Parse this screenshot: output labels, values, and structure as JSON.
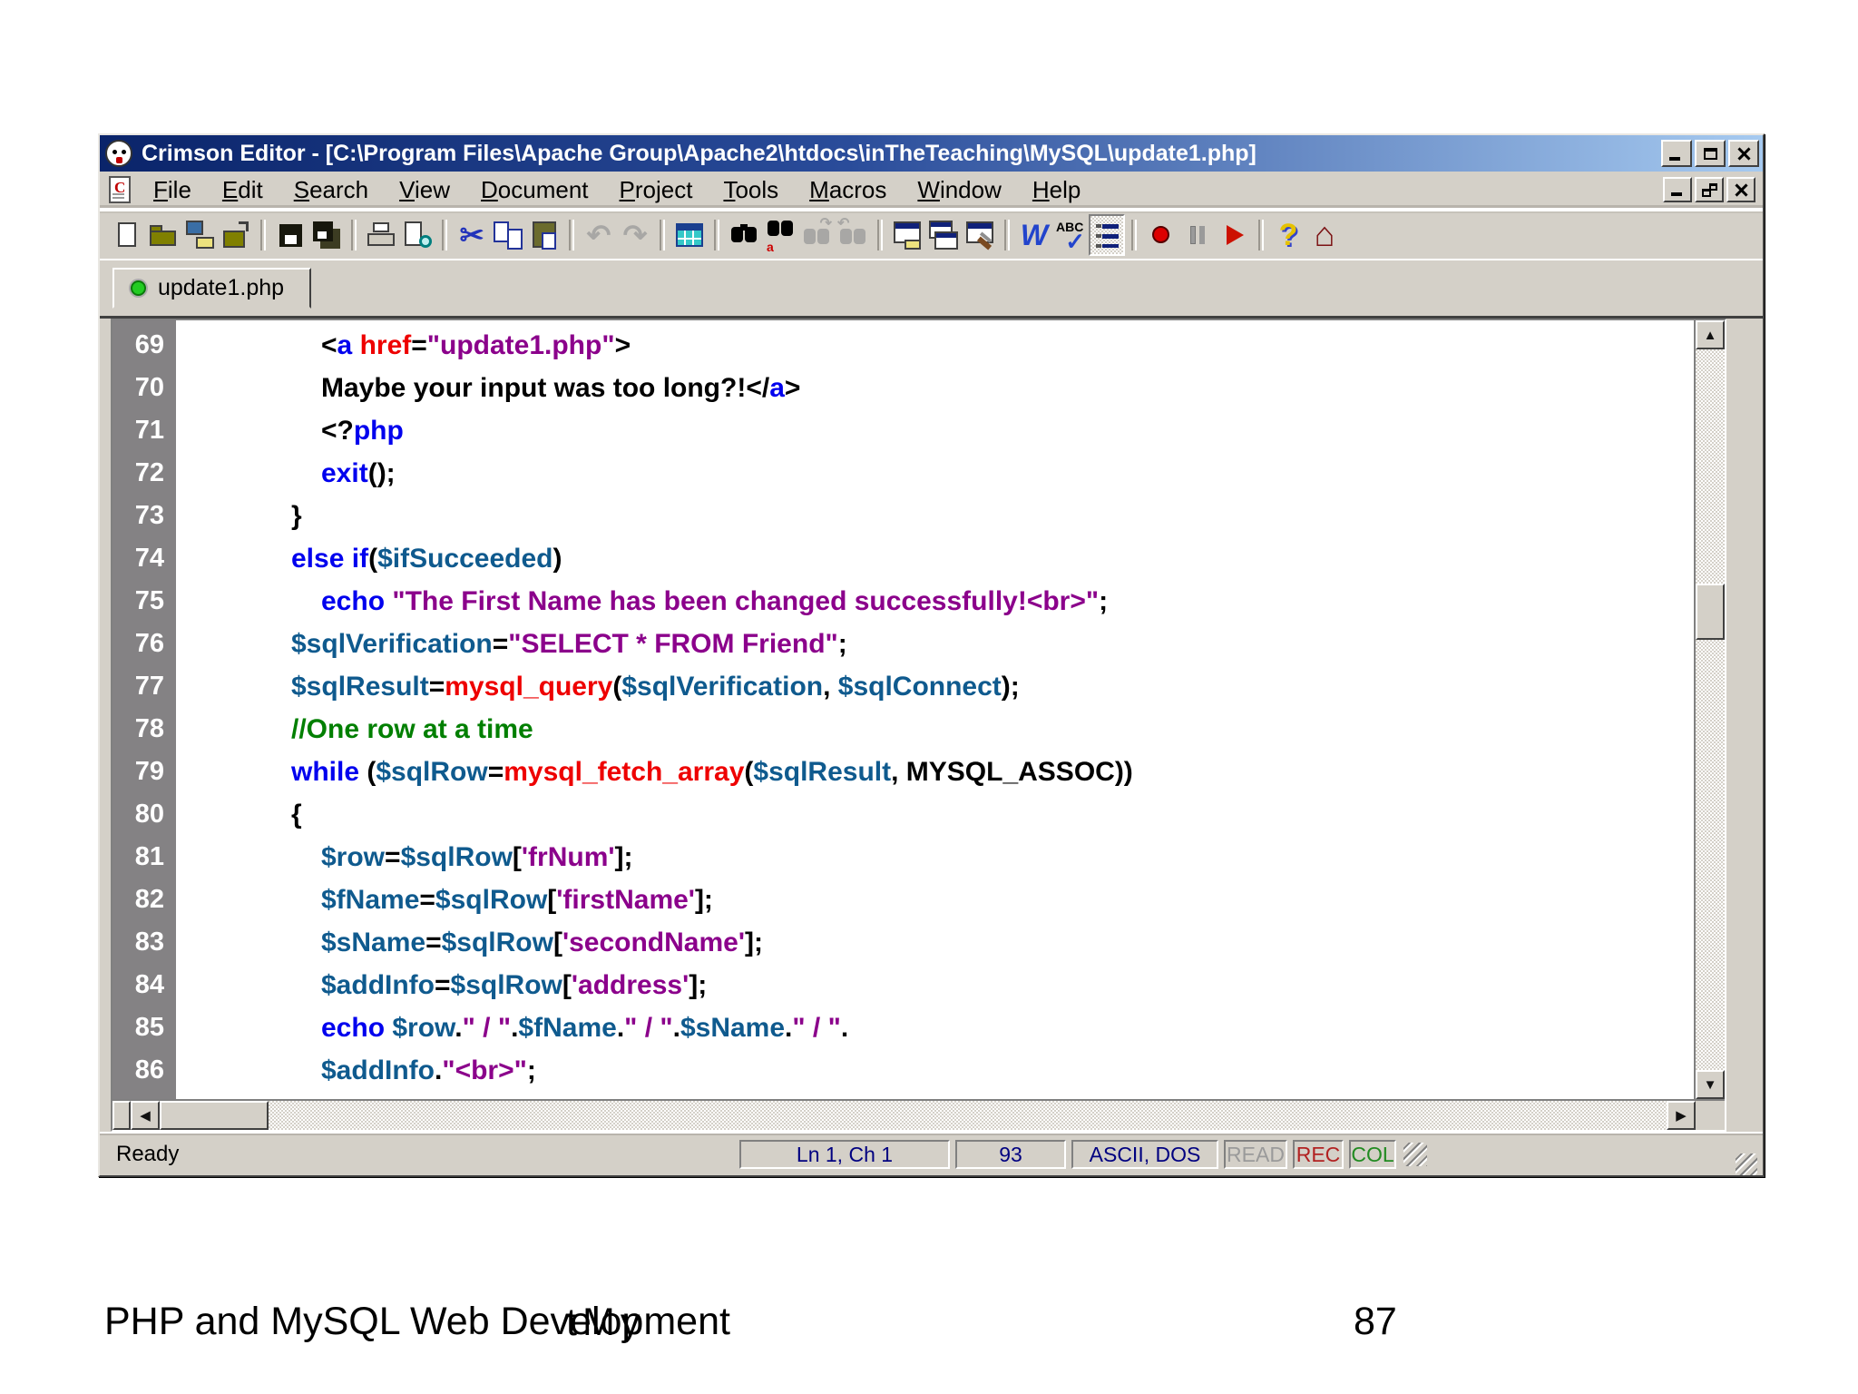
{
  "window": {
    "title": "Crimson Editor - [C:\\Program Files\\Apache Group\\Apache2\\htdocs\\inTheTeaching\\MySQL\\update1.php]",
    "menu": [
      "File",
      "Edit",
      "Search",
      "View",
      "Document",
      "Project",
      "Tools",
      "Macros",
      "Window",
      "Help"
    ],
    "toolbar": {
      "groups": [
        [
          {
            "name": "new-file-icon"
          },
          {
            "name": "open-file-icon"
          },
          {
            "name": "open-remote-icon"
          },
          {
            "name": "close-folder-icon"
          }
        ],
        [
          {
            "name": "save-icon"
          },
          {
            "name": "save-all-icon"
          }
        ],
        [
          {
            "name": "print-icon"
          },
          {
            "name": "print-preview-icon"
          }
        ],
        [
          {
            "name": "cut-icon",
            "glyph": "✂"
          },
          {
            "name": "copy-icon"
          },
          {
            "name": "paste-icon"
          }
        ],
        [
          {
            "name": "undo-icon",
            "glyph": "↶",
            "disabled": true
          },
          {
            "name": "redo-icon",
            "glyph": "↷",
            "disabled": true
          }
        ],
        [
          {
            "name": "grid-icon"
          }
        ],
        [
          {
            "name": "find-icon"
          },
          {
            "name": "replace-icon"
          },
          {
            "name": "find-next-icon",
            "disabled": true
          },
          {
            "name": "find-prev-icon",
            "disabled": true
          }
        ],
        [
          {
            "name": "project-pane-icon"
          },
          {
            "name": "window-list-icon"
          },
          {
            "name": "tools-pane-icon"
          }
        ],
        [
          {
            "name": "word-wrap-icon",
            "glyph": "W"
          },
          {
            "name": "spell-check-icon"
          },
          {
            "name": "line-numbers-icon",
            "pressed": true
          }
        ],
        [
          {
            "name": "record-macro-icon"
          },
          {
            "name": "pause-macro-icon"
          },
          {
            "name": "play-macro-icon"
          }
        ],
        [
          {
            "name": "help-icon",
            "glyph": "?"
          },
          {
            "name": "home-icon",
            "glyph": "⌂"
          }
        ]
      ]
    },
    "tab": {
      "label": "update1.php"
    },
    "status": {
      "ready": "Ready",
      "panels": [
        {
          "text": "Ln 1, Ch 1",
          "style": "navy"
        },
        {
          "text": "93",
          "style": "navy"
        },
        {
          "text": "ASCII, DOS",
          "style": "navy"
        },
        {
          "text": "READ",
          "style": "muted"
        },
        {
          "text": "REC",
          "style": "red"
        },
        {
          "text": "COL",
          "style": "green"
        }
      ]
    }
  },
  "icons": {
    "up": "▲",
    "down": "▼",
    "left": "◀",
    "right": "▶"
  },
  "colors": {
    "titlebar_start": "#0A246A",
    "titlebar_end": "#A6CAF0",
    "chrome": "#D4D0C8",
    "gutter": "#848284",
    "keyword": "#0000EE",
    "function": "#EE0000",
    "string": "#8B008B",
    "variable": "#0F5A8E",
    "comment": "#007F00"
  },
  "editor": {
    "lines": [
      {
        "n": 69,
        "i": 2,
        "t": [
          [
            "p",
            "<"
          ],
          [
            "k",
            "a"
          ],
          [
            "p",
            " "
          ],
          [
            "f",
            "href"
          ],
          [
            "p",
            "="
          ],
          [
            "s",
            "\"update1.php\""
          ],
          [
            "p",
            ">"
          ]
        ]
      },
      {
        "n": 70,
        "i": 2,
        "t": [
          [
            "p",
            "Maybe your input was too long?!"
          ],
          [
            "p",
            "</"
          ],
          [
            "k",
            "a"
          ],
          [
            "p",
            ">"
          ]
        ]
      },
      {
        "n": 71,
        "i": 2,
        "t": [
          [
            "p",
            "<?"
          ],
          [
            "k",
            "php"
          ]
        ]
      },
      {
        "n": 72,
        "i": 2,
        "t": [
          [
            "k",
            "exit"
          ],
          [
            "p",
            "();"
          ]
        ]
      },
      {
        "n": 73,
        "i": 1,
        "t": [
          [
            "p",
            "}"
          ]
        ]
      },
      {
        "n": 74,
        "i": 1,
        "t": [
          [
            "k",
            "else"
          ],
          [
            "p",
            " "
          ],
          [
            "k",
            "if"
          ],
          [
            "p",
            "("
          ],
          [
            "v",
            "$ifSucceeded"
          ],
          [
            "p",
            ")"
          ]
        ]
      },
      {
        "n": 75,
        "i": 2,
        "t": [
          [
            "k",
            "echo"
          ],
          [
            "p",
            " "
          ],
          [
            "s",
            "\"The First Name has been changed successfully!<br>\""
          ],
          [
            "p",
            ";"
          ]
        ]
      },
      {
        "n": 76,
        "i": 1,
        "t": [
          [
            "v",
            "$sqlVerification"
          ],
          [
            "p",
            "="
          ],
          [
            "s",
            "\"SELECT * FROM Friend\""
          ],
          [
            "p",
            ";"
          ]
        ]
      },
      {
        "n": 77,
        "i": 1,
        "t": [
          [
            "v",
            "$sqlResult"
          ],
          [
            "p",
            "="
          ],
          [
            "f",
            "mysql_query"
          ],
          [
            "p",
            "("
          ],
          [
            "v",
            "$sqlVerification"
          ],
          [
            "p",
            ", "
          ],
          [
            "v",
            "$sqlConnect"
          ],
          [
            "p",
            ");"
          ]
        ]
      },
      {
        "n": 78,
        "i": 1,
        "t": [
          [
            "c",
            "//One row at a time"
          ]
        ]
      },
      {
        "n": 79,
        "i": 1,
        "t": [
          [
            "k",
            "while"
          ],
          [
            "p",
            " ("
          ],
          [
            "v",
            "$sqlRow"
          ],
          [
            "p",
            "="
          ],
          [
            "f",
            "mysql_fetch_array"
          ],
          [
            "p",
            "("
          ],
          [
            "v",
            "$sqlResult"
          ],
          [
            "p",
            ", MYSQL_ASSOC))"
          ]
        ]
      },
      {
        "n": 80,
        "i": 1,
        "t": [
          [
            "p",
            "{"
          ]
        ]
      },
      {
        "n": 81,
        "i": 2,
        "t": [
          [
            "v",
            "$row"
          ],
          [
            "p",
            "="
          ],
          [
            "v",
            "$sqlRow"
          ],
          [
            "p",
            "["
          ],
          [
            "s",
            "'frNum'"
          ],
          [
            "p",
            "];"
          ]
        ]
      },
      {
        "n": 82,
        "i": 2,
        "t": [
          [
            "v",
            "$fName"
          ],
          [
            "p",
            "="
          ],
          [
            "v",
            "$sqlRow"
          ],
          [
            "p",
            "["
          ],
          [
            "s",
            "'firstName'"
          ],
          [
            "p",
            "];"
          ]
        ]
      },
      {
        "n": 83,
        "i": 2,
        "t": [
          [
            "v",
            "$sName"
          ],
          [
            "p",
            "="
          ],
          [
            "v",
            "$sqlRow"
          ],
          [
            "p",
            "["
          ],
          [
            "s",
            "'secondName'"
          ],
          [
            "p",
            "];"
          ]
        ]
      },
      {
        "n": 84,
        "i": 2,
        "t": [
          [
            "v",
            "$addInfo"
          ],
          [
            "p",
            "="
          ],
          [
            "v",
            "$sqlRow"
          ],
          [
            "p",
            "["
          ],
          [
            "s",
            "'address'"
          ],
          [
            "p",
            "];"
          ]
        ]
      },
      {
        "n": 85,
        "i": 2,
        "t": [
          [
            "k",
            "echo"
          ],
          [
            "p",
            " "
          ],
          [
            "v",
            "$row"
          ],
          [
            "p",
            "."
          ],
          [
            "s",
            "\" / \""
          ],
          [
            "p",
            "."
          ],
          [
            "v",
            "$fName"
          ],
          [
            "p",
            "."
          ],
          [
            "s",
            "\" / \""
          ],
          [
            "p",
            "."
          ],
          [
            "v",
            "$sName"
          ],
          [
            "p",
            "."
          ],
          [
            "s",
            "\" / \""
          ],
          [
            "p",
            "."
          ]
        ]
      },
      {
        "n": 86,
        "i": 2,
        "t": [
          [
            "v",
            "$addInfo"
          ],
          [
            "p",
            "."
          ],
          [
            "s",
            "\"<br>\""
          ],
          [
            "p",
            ";"
          ]
        ]
      }
    ]
  },
  "footer": {
    "pre": "PHP and MySQL Web Dev",
    "post": "elopment",
    "overlay": "tMy",
    "page": "87"
  }
}
